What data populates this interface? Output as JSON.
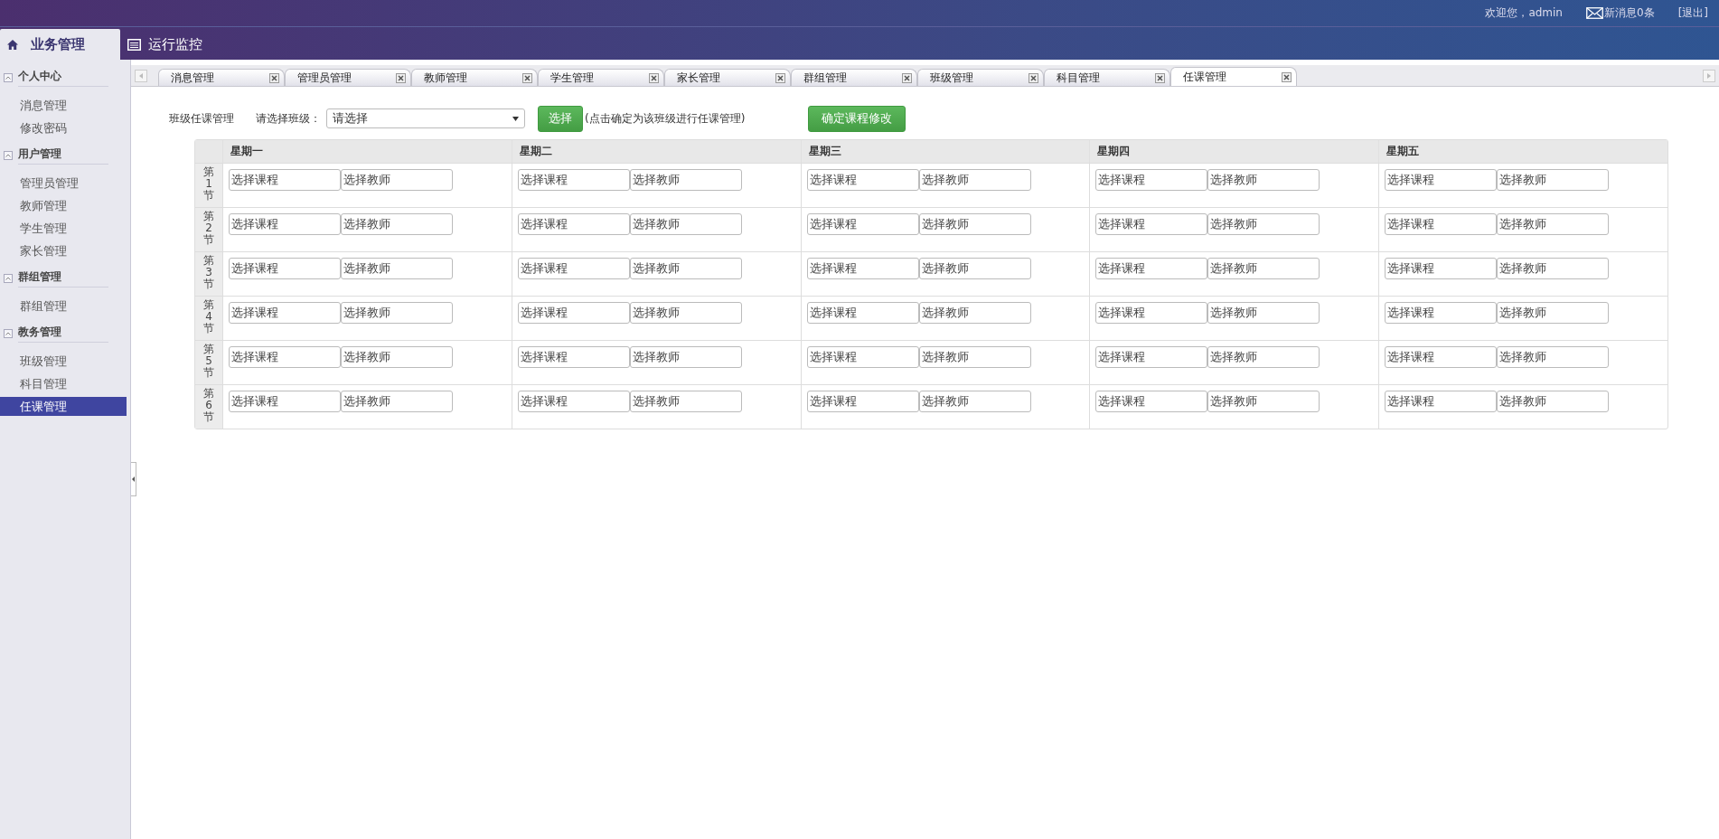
{
  "header": {
    "welcome": "欢迎您，admin",
    "messages": "新消息0条",
    "logout": "[退出]"
  },
  "top_nav": [
    {
      "label": "业务管理",
      "selected": true
    },
    {
      "label": "运行监控",
      "selected": false
    }
  ],
  "sidebar": {
    "groups": [
      {
        "title": "个人中心",
        "expanded": true,
        "items": [
          {
            "label": "消息管理",
            "selected": false
          },
          {
            "label": "修改密码",
            "selected": false
          }
        ]
      },
      {
        "title": "用户管理",
        "expanded": true,
        "items": [
          {
            "label": "管理员管理",
            "selected": false
          },
          {
            "label": "教师管理",
            "selected": false
          },
          {
            "label": "学生管理",
            "selected": false
          },
          {
            "label": "家长管理",
            "selected": false
          }
        ]
      },
      {
        "title": "群组管理",
        "expanded": true,
        "items": [
          {
            "label": "群组管理",
            "selected": false
          }
        ]
      },
      {
        "title": "教务管理",
        "expanded": true,
        "items": [
          {
            "label": "班级管理",
            "selected": false
          },
          {
            "label": "科目管理",
            "selected": false
          },
          {
            "label": "任课管理",
            "selected": true
          }
        ]
      }
    ]
  },
  "tabs": [
    {
      "label": "消息管理",
      "selected": false
    },
    {
      "label": "管理员管理",
      "selected": false
    },
    {
      "label": "教师管理",
      "selected": false
    },
    {
      "label": "学生管理",
      "selected": false
    },
    {
      "label": "家长管理",
      "selected": false
    },
    {
      "label": "群组管理",
      "selected": false
    },
    {
      "label": "班级管理",
      "selected": false
    },
    {
      "label": "科目管理",
      "selected": false
    },
    {
      "label": "任课管理",
      "selected": true
    }
  ],
  "toolbar": {
    "title": "班级任课管理",
    "class_label": "请选择班级：",
    "class_select": "请选择",
    "select_button": "选择",
    "hint": "(点击确定为该班级进行任课管理)",
    "confirm_button": "确定课程修改"
  },
  "schedule": {
    "columns": [
      "星期一",
      "星期二",
      "星期三",
      "星期四",
      "星期五"
    ],
    "rows": [
      {
        "period": "第1节",
        "cells": [
          {
            "course": "选择课程",
            "teacher": "选择教师"
          },
          {
            "course": "选择课程",
            "teacher": "选择教师"
          },
          {
            "course": "选择课程",
            "teacher": "选择教师"
          },
          {
            "course": "选择课程",
            "teacher": "选择教师"
          },
          {
            "course": "选择课程",
            "teacher": "选择教师"
          }
        ]
      },
      {
        "period": "第2节",
        "cells": [
          {
            "course": "选择课程",
            "teacher": "选择教师"
          },
          {
            "course": "选择课程",
            "teacher": "选择教师"
          },
          {
            "course": "选择课程",
            "teacher": "选择教师"
          },
          {
            "course": "选择课程",
            "teacher": "选择教师"
          },
          {
            "course": "选择课程",
            "teacher": "选择教师"
          }
        ]
      },
      {
        "period": "第3节",
        "cells": [
          {
            "course": "选择课程",
            "teacher": "选择教师"
          },
          {
            "course": "选择课程",
            "teacher": "选择教师"
          },
          {
            "course": "选择课程",
            "teacher": "选择教师"
          },
          {
            "course": "选择课程",
            "teacher": "选择教师"
          },
          {
            "course": "选择课程",
            "teacher": "选择教师"
          }
        ]
      },
      {
        "period": "第4节",
        "cells": [
          {
            "course": "选择课程",
            "teacher": "选择教师"
          },
          {
            "course": "选择课程",
            "teacher": "选择教师"
          },
          {
            "course": "选择课程",
            "teacher": "选择教师"
          },
          {
            "course": "选择课程",
            "teacher": "选择教师"
          },
          {
            "course": "选择课程",
            "teacher": "选择教师"
          }
        ]
      },
      {
        "period": "第5节",
        "cells": [
          {
            "course": "选择课程",
            "teacher": "选择教师"
          },
          {
            "course": "选择课程",
            "teacher": "选择教师"
          },
          {
            "course": "选择课程",
            "teacher": "选择教师"
          },
          {
            "course": "选择课程",
            "teacher": "选择教师"
          },
          {
            "course": "选择课程",
            "teacher": "选择教师"
          }
        ]
      },
      {
        "period": "第6节",
        "cells": [
          {
            "course": "选择课程",
            "teacher": "选择教师"
          },
          {
            "course": "选择课程",
            "teacher": "选择教师"
          },
          {
            "course": "选择课程",
            "teacher": "选择教师"
          },
          {
            "course": "选择课程",
            "teacher": "选择教师"
          },
          {
            "course": "选择课程",
            "teacher": "选择教师"
          }
        ]
      }
    ]
  }
}
